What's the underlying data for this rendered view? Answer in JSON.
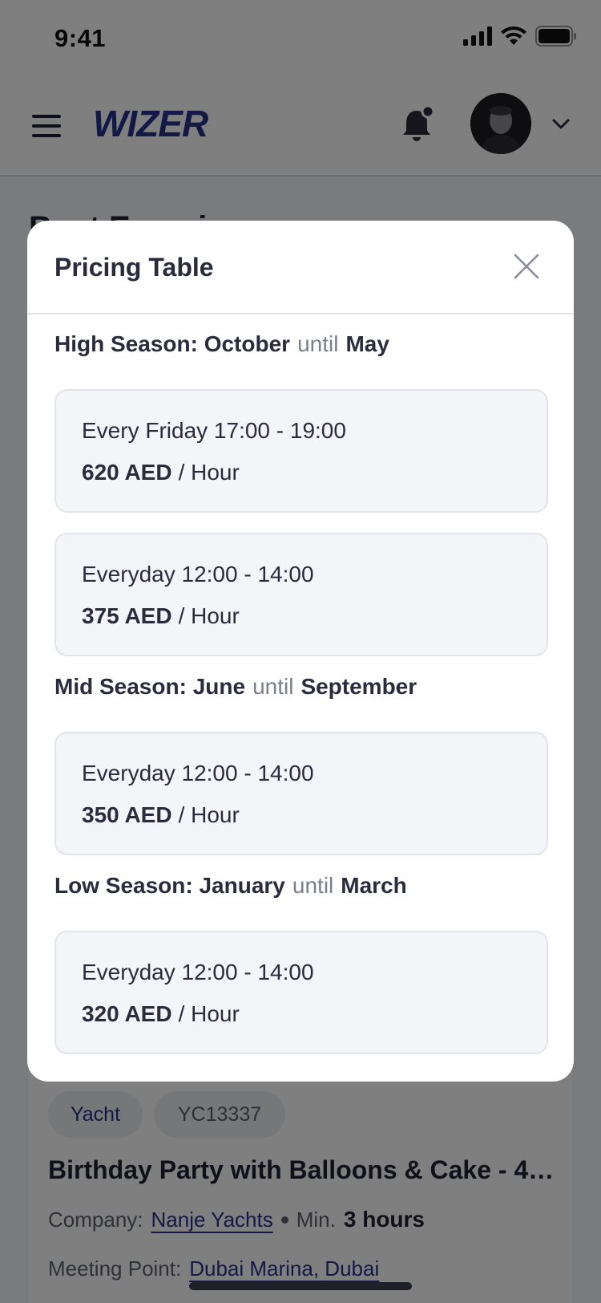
{
  "status_bar": {
    "time": "9:41"
  },
  "header": {
    "logo_text": "WIZER",
    "menu_icon": "hamburger-icon",
    "notification_icon": "bell-icon",
    "account_icon": "chevron-down-icon",
    "brand_color": "#27308a"
  },
  "background_page": {
    "title": "Boat Experiences",
    "listing": {
      "tags": [
        "Yacht",
        "YC13337"
      ],
      "title": "Birthday Party with Balloons & Cake - 48...",
      "company_label": "Company:",
      "company_name": "Nanje Yachts",
      "min_label": "Min.",
      "min_value": "3 hours",
      "meeting_label": "Meeting Point:",
      "meeting_value": "Dubai Marina, Dubai"
    }
  },
  "modal": {
    "title": "Pricing Table",
    "close_icon": "close-icon",
    "seasons": [
      {
        "name": "High Season:",
        "from": "October",
        "until_label": "until",
        "to": "May",
        "prices": [
          {
            "schedule": "Every Friday 17:00 - 19:00",
            "amount": "620 AED",
            "unit": "/ Hour"
          },
          {
            "schedule": "Everyday 12:00 - 14:00",
            "amount": "375 AED",
            "unit": "/ Hour"
          }
        ]
      },
      {
        "name": "Mid Season:",
        "from": "June",
        "until_label": "until",
        "to": "September",
        "prices": [
          {
            "schedule": "Everyday 12:00 - 14:00",
            "amount": "350 AED",
            "unit": "/ Hour"
          }
        ]
      },
      {
        "name": "Low Season:",
        "from": "January",
        "until_label": "until",
        "to": "March",
        "prices": [
          {
            "schedule": "Everyday 12:00 - 14:00",
            "amount": "320 AED",
            "unit": "/ Hour"
          }
        ]
      }
    ]
  }
}
